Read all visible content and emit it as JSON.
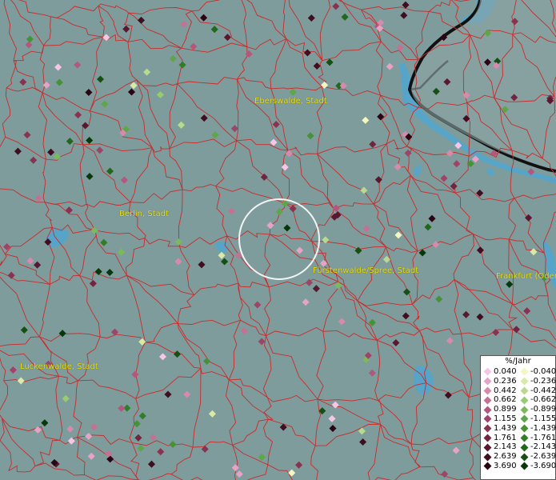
{
  "map": {
    "colors": {
      "background": "#7e9c9c",
      "border_lines": "#cc2a2a",
      "water": "#4aa8d8",
      "national_border": "#111111"
    },
    "cities": [
      {
        "name": "Eberswalde, Stadt"
      },
      {
        "name": "Berlin, Stadt"
      },
      {
        "name": "Fürstenwalde/Spree, Stadt"
      },
      {
        "name": "Frankfurt (Oder), Stadt"
      },
      {
        "name": "Luckenwalde, Stadt"
      }
    ],
    "selection_ring": "circle-highlight"
  },
  "legend": {
    "title": "%/Jahr",
    "positive": [
      {
        "label": "0.040",
        "color": "#f7c6e6"
      },
      {
        "label": "0.236",
        "color": "#e6a3c6"
      },
      {
        "label": "0.442",
        "color": "#d78aac"
      },
      {
        "label": "0.662",
        "color": "#c57193"
      },
      {
        "label": "0.899",
        "color": "#b4577e"
      },
      {
        "label": "1.155",
        "color": "#9e4468"
      },
      {
        "label": "1.439",
        "color": "#883352"
      },
      {
        "label": "1.761",
        "color": "#712540"
      },
      {
        "label": "2.143",
        "color": "#591830"
      },
      {
        "label": "2.639",
        "color": "#410d20"
      },
      {
        "label": "3.690",
        "color": "#2a0412"
      }
    ],
    "negative": [
      {
        "label": "-0.040",
        "color": "#f5f7c0"
      },
      {
        "label": "-0.236",
        "color": "#d8eaa8"
      },
      {
        "label": "-0.442",
        "color": "#b7db8e"
      },
      {
        "label": "-0.662",
        "color": "#98cc74"
      },
      {
        "label": "-0.899",
        "color": "#7aba5c"
      },
      {
        "label": "-1.155",
        "color": "#5ea648"
      },
      {
        "label": "-1.439",
        "color": "#469236"
      },
      {
        "label": "-1.761",
        "color": "#327d28"
      },
      {
        "label": "-2.143",
        "color": "#21671c"
      },
      {
        "label": "-2.639",
        "color": "#135012"
      },
      {
        "label": "-3.690",
        "color": "#07380a"
      }
    ]
  }
}
